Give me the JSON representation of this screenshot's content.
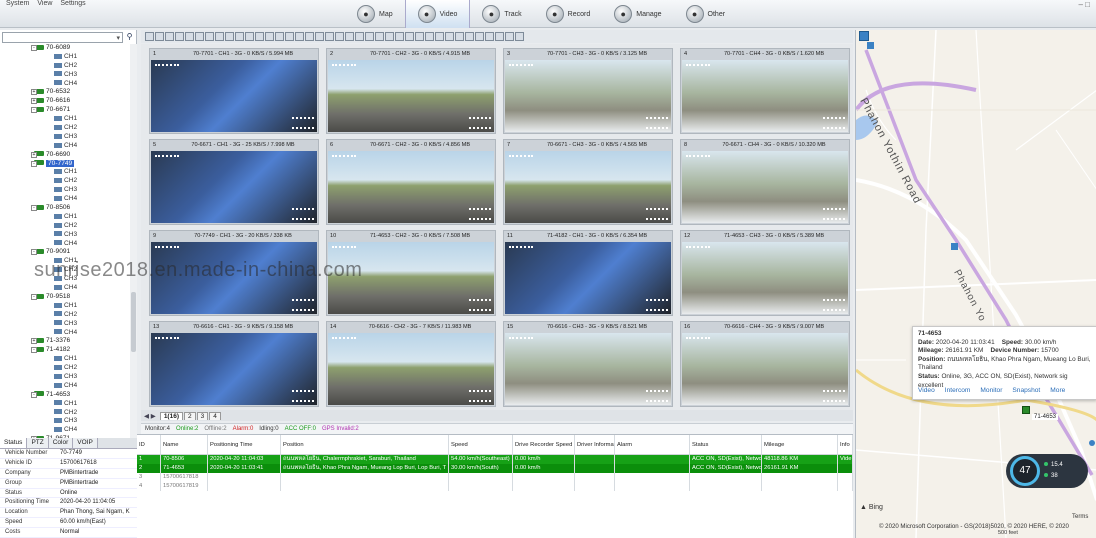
{
  "menubar": [
    "System",
    "View",
    "Settings"
  ],
  "modules": [
    {
      "label": "Map",
      "icon": "map-icon"
    },
    {
      "label": "Video",
      "icon": "video-icon",
      "active": true
    },
    {
      "label": "Track",
      "icon": "track-icon"
    },
    {
      "label": "Record",
      "icon": "record-icon"
    },
    {
      "label": "Manage",
      "icon": "manage-icon"
    },
    {
      "label": "Other",
      "icon": "other-icon"
    }
  ],
  "tree": [
    {
      "type": "dev",
      "label": "70-6089",
      "toggle": "-"
    },
    {
      "type": "ch",
      "label": "CH1"
    },
    {
      "type": "ch",
      "label": "CH2"
    },
    {
      "type": "ch",
      "label": "CH3"
    },
    {
      "type": "ch",
      "label": "CH4"
    },
    {
      "type": "dev",
      "label": "70-6532",
      "toggle": "+"
    },
    {
      "type": "dev",
      "label": "70-6616",
      "toggle": "+"
    },
    {
      "type": "dev",
      "label": "70-6671",
      "toggle": "-"
    },
    {
      "type": "ch",
      "label": "CH1"
    },
    {
      "type": "ch",
      "label": "CH2"
    },
    {
      "type": "ch",
      "label": "CH3"
    },
    {
      "type": "ch",
      "label": "CH4"
    },
    {
      "type": "dev",
      "label": "70-6690",
      "toggle": "+"
    },
    {
      "type": "dev",
      "label": "70-7749",
      "toggle": "-",
      "selected": true
    },
    {
      "type": "ch",
      "label": "CH1"
    },
    {
      "type": "ch",
      "label": "CH2"
    },
    {
      "type": "ch",
      "label": "CH3"
    },
    {
      "type": "ch",
      "label": "CH4"
    },
    {
      "type": "dev",
      "label": "70-8506",
      "toggle": "-"
    },
    {
      "type": "ch",
      "label": "CH1"
    },
    {
      "type": "ch",
      "label": "CH2"
    },
    {
      "type": "ch",
      "label": "CH3"
    },
    {
      "type": "ch",
      "label": "CH4"
    },
    {
      "type": "dev",
      "label": "70-9091",
      "toggle": "-"
    },
    {
      "type": "ch",
      "label": "CH1"
    },
    {
      "type": "ch",
      "label": "CH2"
    },
    {
      "type": "ch",
      "label": "CH3"
    },
    {
      "type": "ch",
      "label": "CH4"
    },
    {
      "type": "dev",
      "label": "70-9518",
      "toggle": "-"
    },
    {
      "type": "ch",
      "label": "CH1"
    },
    {
      "type": "ch",
      "label": "CH2"
    },
    {
      "type": "ch",
      "label": "CH3"
    },
    {
      "type": "ch",
      "label": "CH4"
    },
    {
      "type": "dev",
      "label": "71-3376",
      "toggle": "+"
    },
    {
      "type": "dev",
      "label": "71-4182",
      "toggle": "-"
    },
    {
      "type": "ch",
      "label": "CH1"
    },
    {
      "type": "ch",
      "label": "CH2"
    },
    {
      "type": "ch",
      "label": "CH3"
    },
    {
      "type": "ch",
      "label": "CH4"
    },
    {
      "type": "dev",
      "label": "71-4653",
      "toggle": "-"
    },
    {
      "type": "ch",
      "label": "CH1"
    },
    {
      "type": "ch",
      "label": "CH2"
    },
    {
      "type": "ch",
      "label": "CH3"
    },
    {
      "type": "ch",
      "label": "CH4"
    },
    {
      "type": "dev",
      "label": "71-9671",
      "toggle": "+"
    }
  ],
  "left_tabs": [
    "Status",
    "PTZ",
    "Color",
    "VOIP"
  ],
  "vehicle_info": [
    {
      "k": "Vehicle Number",
      "v": "70-7749"
    },
    {
      "k": "Vehicle ID",
      "v": "15700617618"
    },
    {
      "k": "Company",
      "v": "PMBintertrade"
    },
    {
      "k": "Group",
      "v": "PMBintertrade"
    },
    {
      "k": "Status",
      "v": "Online"
    },
    {
      "k": "Positioning Time",
      "v": "2020-04-20 11:04:05"
    },
    {
      "k": "Location",
      "v": "Phan Thong, Sai Ngam, K"
    },
    {
      "k": "Speed",
      "v": "60.00 km/h(East)"
    },
    {
      "k": "Costs",
      "v": "Normal"
    }
  ],
  "tiles": [
    {
      "n": "1",
      "cap": "70-7701 - CH1 - 3G - 0 KB/S / 5.994 MB",
      "scene": "cabin"
    },
    {
      "n": "2",
      "cap": "70-7701 - CH2 - 3G - 0 KB/S / 4.915 MB",
      "scene": "road"
    },
    {
      "n": "3",
      "cap": "70-7701 - CH3 - 3G - 0 KB/S / 3.125 MB",
      "scene": "side"
    },
    {
      "n": "4",
      "cap": "70-7701 - CH4 - 3G - 0 KB/S / 1.620 MB",
      "scene": "side"
    },
    {
      "n": "5",
      "cap": "70-6671 - CH1 - 3G - 25 KB/S / 7.998 MB",
      "scene": "cabin"
    },
    {
      "n": "6",
      "cap": "70-6671 - CH2 - 3G - 0 KB/S / 4.856 MB",
      "scene": "road"
    },
    {
      "n": "7",
      "cap": "70-6671 - CH3 - 3G - 0 KB/S / 4.565 MB",
      "scene": "road"
    },
    {
      "n": "8",
      "cap": "70-6671 - CH4 - 3G - 0 KB/S / 10.320 MB",
      "scene": "side"
    },
    {
      "n": "9",
      "cap": "70-7749 - CH1 - 3G - 20 KB/S / 338 KB",
      "scene": "cabin"
    },
    {
      "n": "10",
      "cap": "71-4653 - CH2 - 3G - 0 KB/S / 7.508 MB",
      "scene": "road"
    },
    {
      "n": "11",
      "cap": "71-4182 - CH1 - 3G - 0 KB/S / 6.354 MB",
      "scene": "cabin"
    },
    {
      "n": "12",
      "cap": "71-4653 - CH3 - 3G - 0 KB/S / 5.389 MB",
      "scene": "side"
    },
    {
      "n": "13",
      "cap": "70-6616 - CH1 - 3G - 9 KB/S / 9.158 MB",
      "scene": "cabin"
    },
    {
      "n": "14",
      "cap": "70-6616 - CH2 - 3G - 7 KB/S / 11.983 MB",
      "scene": "road"
    },
    {
      "n": "15",
      "cap": "70-6616 - CH3 - 3G - 9 KB/S / 8.521 MB",
      "scene": "side"
    },
    {
      "n": "16",
      "cap": "70-6616 - CH4 - 3G - 9 KB/S / 9.007 MB",
      "scene": "side"
    }
  ],
  "pages": [
    {
      "label": "1(16)",
      "active": true
    },
    {
      "label": "2"
    },
    {
      "label": "3"
    },
    {
      "label": "4"
    }
  ],
  "summary": [
    {
      "t": "Monitor:4",
      "color": "#333333"
    },
    {
      "t": "Online:2",
      "color": "#1a9a1a"
    },
    {
      "t": "Offline:2",
      "color": "#777777"
    },
    {
      "t": "Alarm:0",
      "color": "#d02020"
    },
    {
      "t": "Idling:0",
      "color": "#333333"
    },
    {
      "t": "ACC OFF:0",
      "color": "#1a9a1a"
    },
    {
      "t": "GPS Invalid:2",
      "color": "#b030b0"
    }
  ],
  "table": {
    "columns": [
      "ID",
      "Name",
      "Positioning Time",
      "Position",
      "Speed",
      "Drive Recorder Speed",
      "Driver Information",
      "Alarm",
      "Status",
      "Mileage",
      "Info"
    ],
    "rows": [
      {
        "style": "green",
        "cells": [
          "1",
          "70-8506",
          "2020-04-20 11:04:03",
          "ถนนพหลโยธิน, Chalermphrakiet, Saraburi, Thailand",
          "54.00 km/h(Southeast)",
          "0.00 km/h",
          "",
          "",
          "ACC ON, SD(Exist), Netwo",
          "48118.86 KM",
          "Vide"
        ]
      },
      {
        "style": "green sel",
        "cells": [
          "2",
          "71-4653",
          "2020-04-20 11:03:41",
          "ถนนพหลโยธิน, Khao Phra Ngam, Mueang Lop Buri, Lop Buri, T",
          "30.00 km/h(South)",
          "0.00 km/h",
          "",
          "",
          "ACC ON, SD(Exist), Netwo",
          "26161.91 KM",
          ""
        ]
      },
      {
        "style": "gray",
        "cells": [
          "3",
          "15700617818",
          "",
          "",
          "",
          "",
          "",
          "",
          "",
          "",
          ""
        ]
      },
      {
        "style": "gray",
        "cells": [
          "4",
          "15700617819",
          "",
          "",
          "",
          "",
          "",
          "",
          "",
          "",
          ""
        ]
      }
    ]
  },
  "map": {
    "road_label_1": "Phahon Yothin Road",
    "road_label_2": "Phahon Yo",
    "popup": {
      "title": "71-4653",
      "date_k": "Date:",
      "date_v": "2020-04-20 11:03:41",
      "speed_k": "Speed:",
      "speed_v": "30.00 km/h",
      "mileage_k": "Mileage:",
      "mileage_v": "26161.91 KM",
      "devno_k": "Device Number:",
      "devno_v": "15700",
      "pos_k": "Position:",
      "pos_v": "ถนนพหลโยธิน, Khao Phra Ngam, Mueang Lo Buri, Thailand",
      "status_k": "Status:",
      "status_v": "Online, 3G, ACC ON, SD(Exist), Network sig excellent",
      "links": [
        "Video",
        "Intercom",
        "Monitor",
        "Snapshot",
        "More"
      ]
    },
    "marker_label": "71-4653",
    "gauge_value": "47",
    "gauge_v1": "15.4",
    "gauge_v2": "38",
    "bing": "Bing",
    "copyright": "© 2020 Microsoft Corporation - GS(2018)5020, © 2020 HERE, © 2020",
    "terms": "Terms",
    "scale": "500 feet"
  },
  "watermark": "sunrise2018.en.made-in-china.com",
  "colors": {
    "online_row": "#16a116",
    "tree_selected": "#3366cc",
    "route": "#c9a6e0"
  }
}
